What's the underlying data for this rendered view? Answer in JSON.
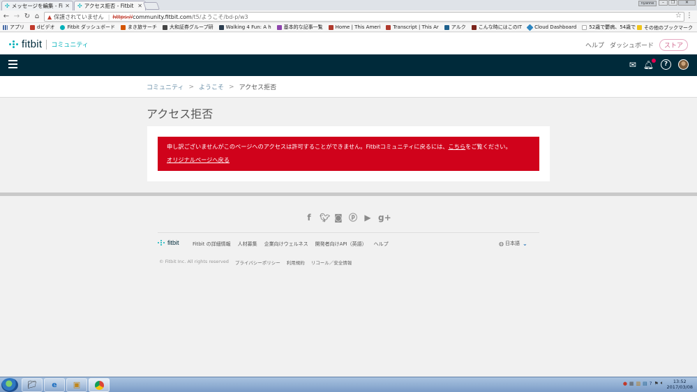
{
  "browser": {
    "tabs": [
      {
        "title": "メッセージを編集 - Fitbit",
        "active": false
      },
      {
        "title": "アクセス拒否 - Fitbit C",
        "active": true
      }
    ],
    "window_user": "nyanne",
    "address": {
      "security_label": "保護されていません",
      "protocol": "https://",
      "host": "community.fitbit.com",
      "path": "/t5/ようこそ/bd-p/w3"
    },
    "bookmarks": [
      {
        "label": "アプリ",
        "color": "#4a6da7"
      },
      {
        "label": "dビデオ",
        "color": "#c0392b"
      },
      {
        "label": "Fitbit ダッシュボード",
        "color": "#00b0b9"
      },
      {
        "label": "まき旅サーチ",
        "color": "#d35400"
      },
      {
        "label": "大和証券グループ研",
        "color": "#444444"
      },
      {
        "label": "Walking 4 Fun: A h",
        "color": "#2c3e50"
      },
      {
        "label": "基本的な記事一覧",
        "color": "#8e44ad"
      },
      {
        "label": "Home | This Ameri",
        "color": "#b03a2e"
      },
      {
        "label": "Transcript | This Ar",
        "color": "#b03a2e"
      },
      {
        "label": "アルク",
        "color": "#1f618d"
      },
      {
        "label": "こんな時にはこのIT",
        "color": "#7b241c"
      },
      {
        "label": "Cloud Dashboard",
        "color": "#2e86c1"
      },
      {
        "label": "52歳で鬱病、54歳で",
        "color": "#aaaaaa"
      }
    ],
    "other_bookmarks": "その他のブックマーク"
  },
  "header": {
    "logo_text": "fitbit",
    "community_label": "コミュニティ",
    "links": {
      "help": "ヘルプ",
      "dashboard": "ダッシュボード",
      "store": "ストア"
    }
  },
  "breadcrumb": {
    "items": [
      "コミュニティ",
      "ようこそ",
      "アクセス拒否"
    ],
    "separator": ">"
  },
  "page": {
    "title": "アクセス拒否",
    "error_pre": "申し訳ございませんがこのページへのアクセスは許可することができません。Fitbitコミュニティに戻るには、",
    "error_link": "こちら",
    "error_post": "をご覧ください。",
    "back_link": "オリジナルページへ戻る"
  },
  "footer": {
    "social_icons": [
      "facebook-icon",
      "twitter-icon",
      "instagram-icon",
      "pinterest-icon",
      "youtube-icon",
      "google-plus-icon"
    ],
    "logo_text": "fitbit",
    "links": [
      "Fitbit の詳細情報",
      "人材募集",
      "企業向けウェルネス",
      "開発者向けAPI（英語）",
      "ヘルプ"
    ],
    "language": "日本語",
    "copyright": "© Fitbit Inc. All rights reserved",
    "legal_links": [
      "プライバシーポリシー",
      "利用規約",
      "リコール／安全情報"
    ]
  },
  "taskbar": {
    "time": "13:52",
    "date": "2017/03/08"
  },
  "colors": {
    "navbar": "#002a3a",
    "brand_teal": "#00b0b9",
    "error_red": "#d0021b",
    "store_pink": "#d0658d"
  }
}
